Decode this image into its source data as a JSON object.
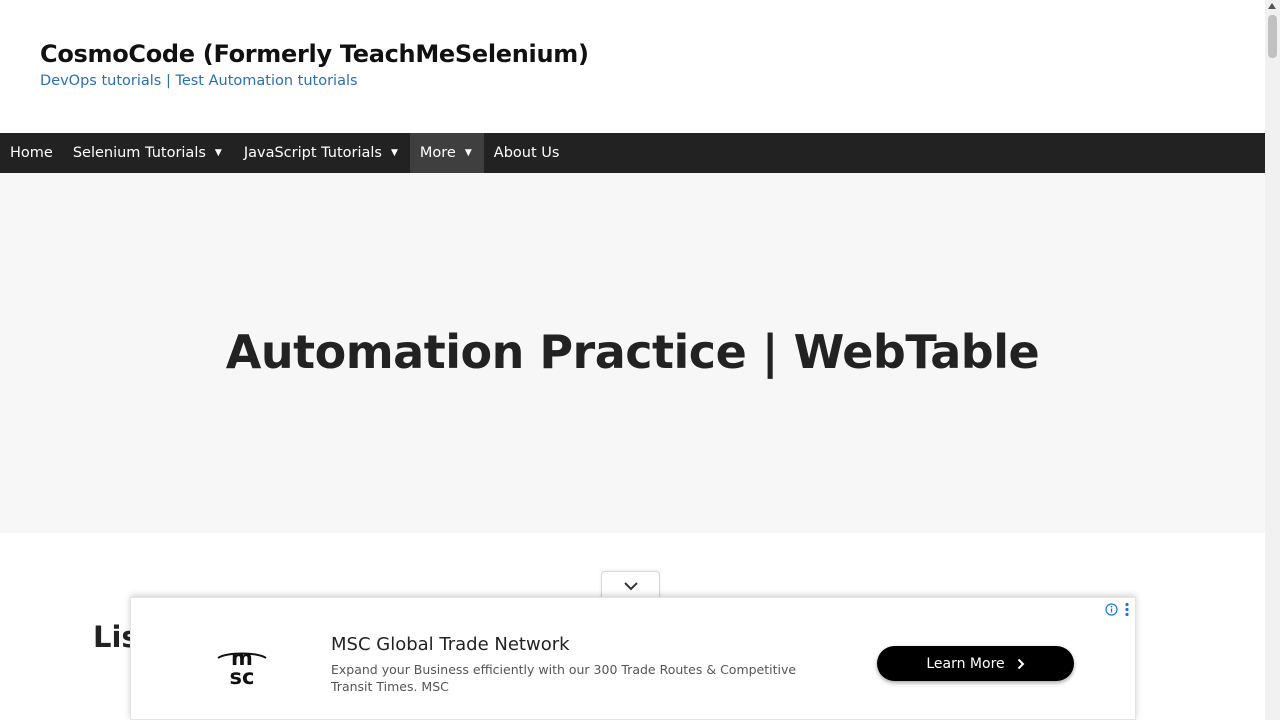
{
  "header": {
    "site_title": "CosmoCode (Formerly TeachMeSelenium)",
    "tagline": "DevOps tutorials | Test Automation tutorials"
  },
  "nav": {
    "items": [
      {
        "label": "Home"
      },
      {
        "label": "Selenium Tutorials"
      },
      {
        "label": "JavaScript Tutorials"
      },
      {
        "label": "More"
      },
      {
        "label": "About Us"
      }
    ]
  },
  "hero": {
    "title": "Automation Practice | WebTable"
  },
  "content": {
    "heading_visible": "Lis"
  },
  "ad": {
    "title": "MSC Global Trade Network",
    "description": "Expand your Business efficiently with our 300 Trade Routes & Competitive Transit Times. MSC",
    "cta": "Learn More",
    "logo_text": "msc",
    "icons": [
      "chevron-down-icon",
      "info-icon",
      "kebab-menu-icon",
      "chevron-right-icon"
    ]
  },
  "colors": {
    "nav_bg": "#222222",
    "nav_active_bg": "#3f3f3f",
    "tagline": "#2a6fb0",
    "hero_bg": "#f7f7f7",
    "ad_button_bg": "#000000"
  }
}
